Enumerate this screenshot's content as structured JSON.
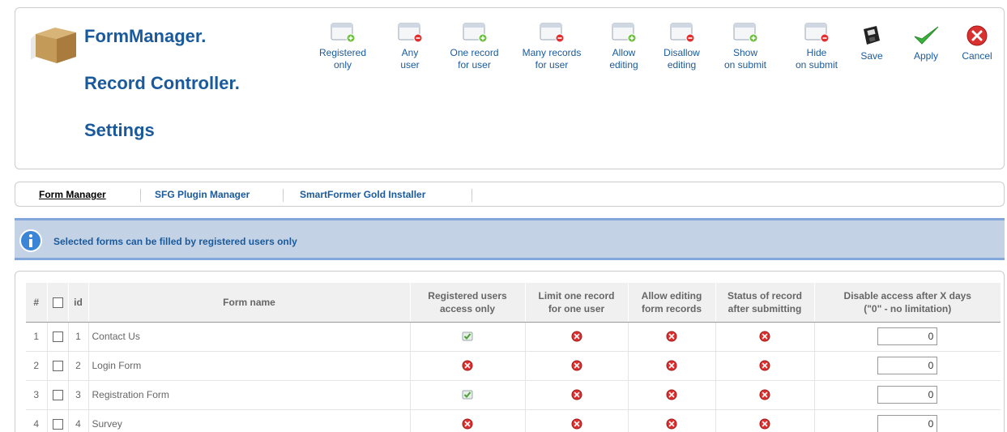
{
  "header": {
    "title_lines": [
      "FormManager.",
      "Record Controller.",
      "Settings"
    ],
    "toolbar": [
      {
        "label": "Registered\nonly",
        "icon": "page-add-icon"
      },
      {
        "label": "Any\nuser",
        "icon": "page-remove-icon"
      },
      {
        "label": "One record\nfor user",
        "icon": "page-add-icon"
      },
      {
        "label": "Many records\nfor user",
        "icon": "page-remove-icon"
      },
      {
        "label": "Allow\nediting",
        "icon": "page-add-icon"
      },
      {
        "label": "Disallow\nediting",
        "icon": "page-remove-icon"
      },
      {
        "label": "Show\non submit",
        "icon": "page-add-icon"
      },
      {
        "label": "Hide\non submit",
        "icon": "page-remove-icon"
      },
      {
        "label": "Save",
        "icon": "floppy-disk-icon"
      },
      {
        "label": "Apply",
        "icon": "checkmark-icon"
      },
      {
        "label": "Cancel",
        "icon": "cancel-icon"
      }
    ]
  },
  "submenu": {
    "items": [
      "Form Manager",
      "SFG Plugin Manager",
      "SmartFormer Gold Installer"
    ],
    "active": "Form Manager"
  },
  "message": {
    "text": "Selected forms can be filled by registered users only"
  },
  "table": {
    "headers": {
      "num": "#",
      "id": "id",
      "form_name": "Form name",
      "registered": "Registered users\naccess only",
      "limit": "Limit one record\nfor one user",
      "allow_edit": "Allow editing\nform records",
      "status": "Status of record\nafter submitting",
      "disable": "Disable access after X days\n(\"0\" - no limitation)"
    },
    "rows": [
      {
        "num": "1",
        "id": "1",
        "name": "Contact Us",
        "registered": "check",
        "limit": "cross",
        "allow_edit": "cross",
        "status": "cross",
        "days": "0"
      },
      {
        "num": "2",
        "id": "2",
        "name": "Login Form",
        "registered": "cross",
        "limit": "cross",
        "allow_edit": "cross",
        "status": "cross",
        "days": "0"
      },
      {
        "num": "3",
        "id": "3",
        "name": "Registration Form",
        "registered": "check",
        "limit": "cross",
        "allow_edit": "cross",
        "status": "cross",
        "days": "0"
      },
      {
        "num": "4",
        "id": "4",
        "name": "Survey",
        "registered": "cross",
        "limit": "cross",
        "allow_edit": "cross",
        "status": "cross",
        "days": "0"
      }
    ]
  },
  "colors": {
    "accent": "#1a5a9c",
    "message_bg": "#c3d2e5",
    "message_border": "#84a7db",
    "add_green": "#6cbf3c",
    "remove_red": "#e03030"
  }
}
